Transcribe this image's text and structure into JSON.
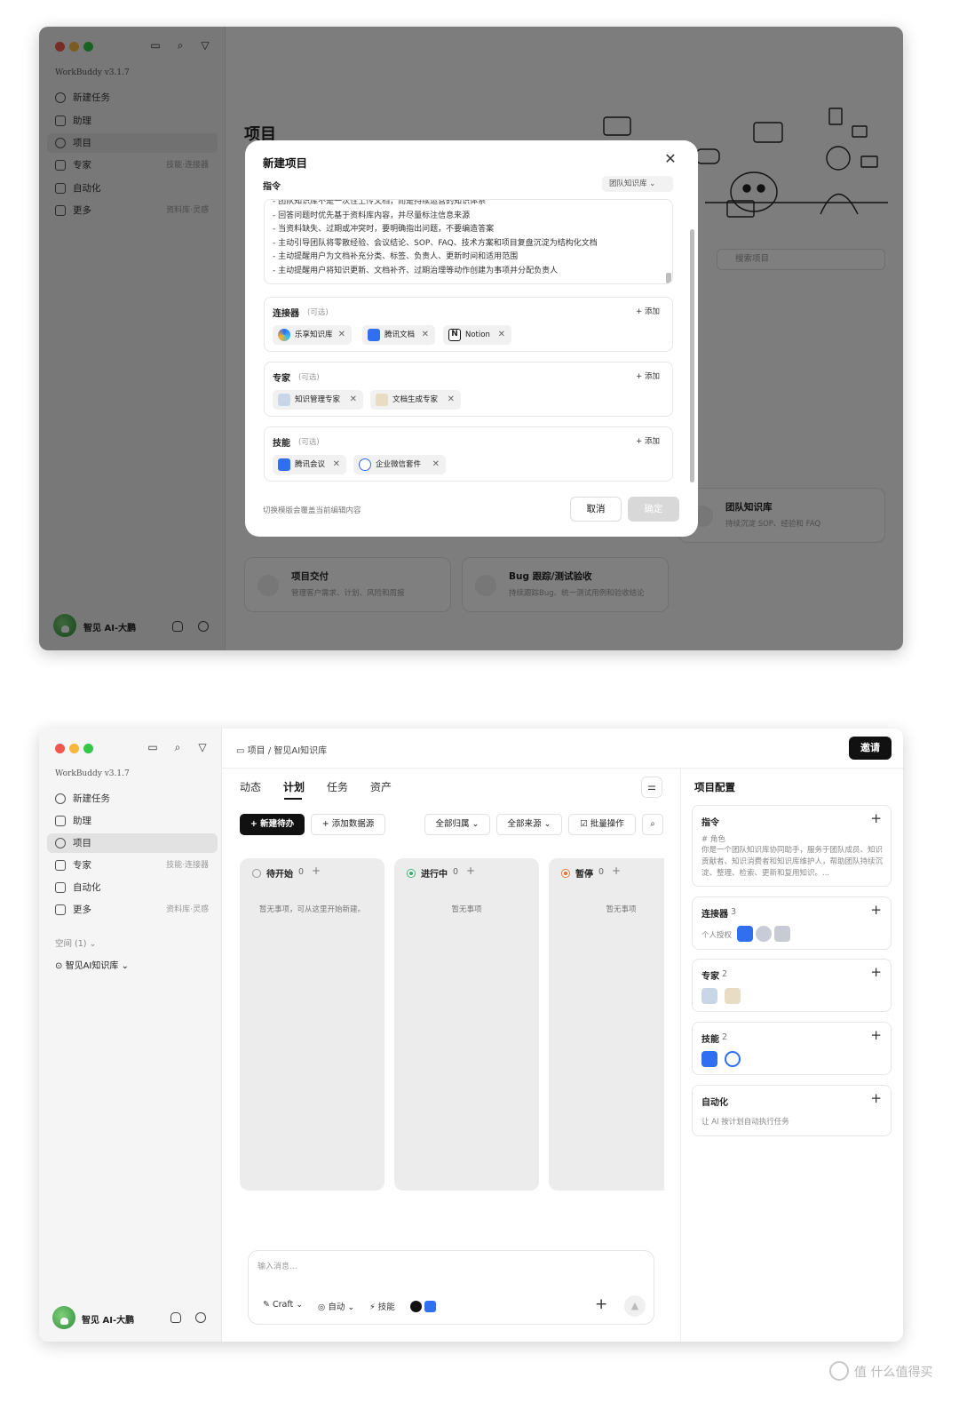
{
  "app": {
    "name": "WorkBuddy",
    "version": "v3.1.7"
  },
  "sidebar": {
    "items": [
      {
        "label": "新建任务",
        "sub": ""
      },
      {
        "label": "助理",
        "sub": ""
      },
      {
        "label": "项目",
        "sub": ""
      },
      {
        "label": "专家",
        "sub": "技能·连接器"
      },
      {
        "label": "自动化",
        "sub": ""
      },
      {
        "label": "更多",
        "sub": "资料库·灵感"
      }
    ],
    "space_label": "空间 (1)",
    "space_item": "智见AI知识库",
    "user_name": "智见 AI-大鹏"
  },
  "window1": {
    "page_title": "项目",
    "search_placeholder": "搜索项目",
    "cards": [
      {
        "title": "团队知识库",
        "sub": "持续沉淀 SOP、经验和 FAQ"
      },
      {
        "title": "项目交付",
        "sub": "管理客户需求、计划、风险和周报"
      },
      {
        "title": "Bug 跟踪/测试验收",
        "sub": "持续跟踪Bug、统一测试用例和验收结论"
      }
    ],
    "modal": {
      "title": "新建项目",
      "instruction_label": "指令",
      "template_select": "团队知识库",
      "instruction_lines": [
        "- 团队知识库不是一次性上传文档，而是持续运营的知识体系",
        "- 回答问题时优先基于资料库内容，并尽量标注信息来源",
        "- 当资料缺失、过期或冲突时，要明确指出问题，不要编造答案",
        "- 主动引导团队将零散经验、会议结论、SOP、FAQ、技术方案和项目复盘沉淀为结构化文档",
        "- 主动提醒用户为文档补充分类、标签、负责人、更新时间和适用范围",
        "- 主动提醒用户将知识更新、文档补齐、过期治理等动作创建为事项并分配负责人"
      ],
      "sections": [
        {
          "title": "连接器",
          "optional": "(可选)",
          "add": "+ 添加",
          "chips": [
            "乐享知识库",
            "腾讯文档",
            "Notion"
          ]
        },
        {
          "title": "专家",
          "optional": "(可选)",
          "add": "+ 添加",
          "chips": [
            "知识管理专家",
            "文档生成专家"
          ]
        },
        {
          "title": "技能",
          "optional": "(可选)",
          "add": "+ 添加",
          "chips": [
            "腾讯会议",
            "企业微信套件"
          ]
        }
      ],
      "footer_hint": "切换模版会覆盖当前编辑内容",
      "cancel": "取消",
      "confirm": "确定",
      "close": "✕"
    }
  },
  "window2": {
    "breadcrumb": "项目 / 智见AI知识库",
    "invite": "邀请",
    "tabs": [
      "动态",
      "计划",
      "任务",
      "资产"
    ],
    "active_tab": "计划",
    "toolbar": {
      "new_todo": "+ 新建待办",
      "add_source": "+ 添加数据源",
      "all_owner": "全部归属",
      "all_source": "全部来源",
      "batch": "批量操作"
    },
    "columns": [
      {
        "title": "待开始",
        "count": "0",
        "empty": "暂无事项，可从这里开始新建。",
        "status_color": "#999999"
      },
      {
        "title": "进行中",
        "count": "0",
        "empty": "暂无事项",
        "status_color": "#3fb06b"
      },
      {
        "title": "暂停",
        "count": "0",
        "empty": "暂无事项",
        "status_color": "#e8743b"
      }
    ],
    "composer": {
      "placeholder": "输入消息...",
      "craft": "Craft",
      "auto": "自动",
      "skills": "技能"
    },
    "right_panel": {
      "title": "项目配置",
      "instruction": {
        "title": "指令",
        "role_label": "# 角色",
        "role_text": "你是一个团队知识库协同助手，服务于团队成员、知识贡献者、知识消费者和知识库维护人，帮助团队持续沉淀、整理、检索、更新和复用知识。..."
      },
      "connectors": {
        "title": "连接器",
        "count": "3",
        "sub": "个人授权"
      },
      "experts": {
        "title": "专家",
        "count": "2"
      },
      "skills": {
        "title": "技能",
        "count": "2"
      },
      "automation": {
        "title": "自动化",
        "sub": "让 AI 按计划自动执行任务"
      }
    }
  },
  "watermark": "值 什么值得买",
  "colors": {
    "accent_dark": "#111111",
    "red": "#f2564d",
    "yellow": "#f6b73d",
    "green": "#35c548",
    "tencent_blue": "#2f6ff0"
  }
}
